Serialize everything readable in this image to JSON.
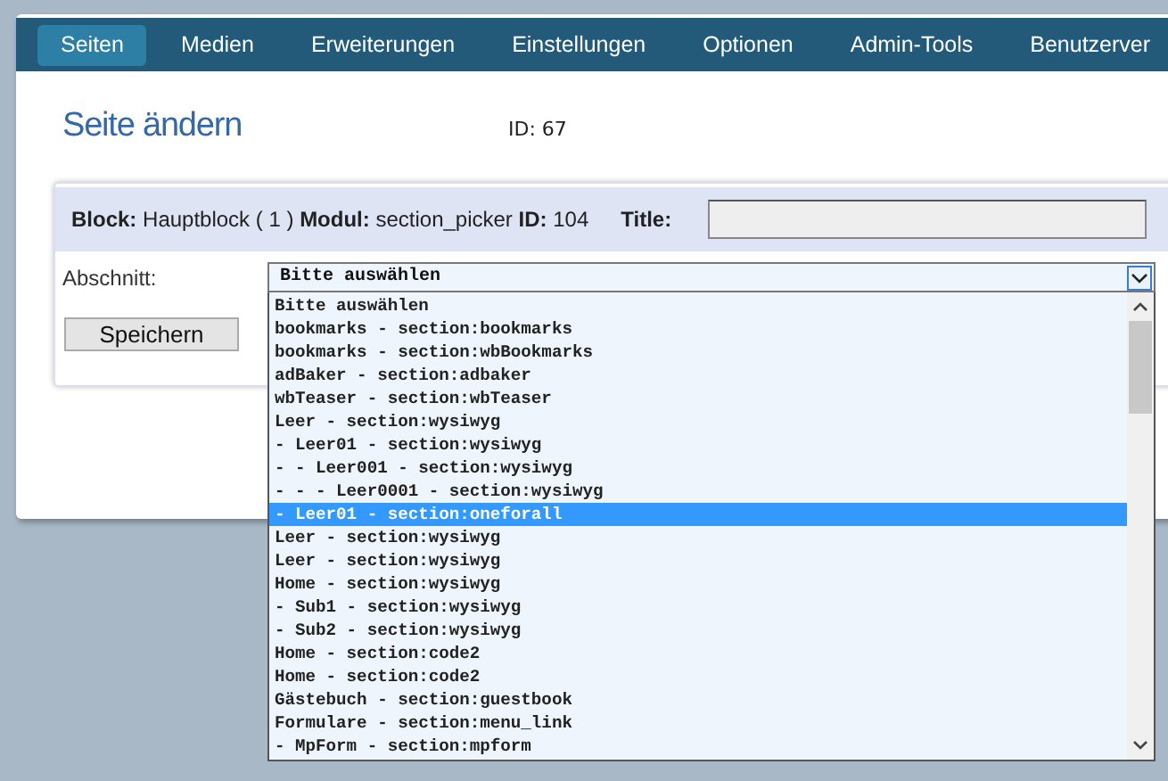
{
  "nav": [
    {
      "label": "Seiten",
      "selected": true
    },
    {
      "label": "Medien",
      "selected": false
    },
    {
      "label": "Erweiterungen",
      "selected": false
    },
    {
      "label": "Einstellungen",
      "selected": false
    },
    {
      "label": "Optionen",
      "selected": false
    },
    {
      "label": "Admin-Tools",
      "selected": false
    },
    {
      "label": "Benutzerver",
      "selected": false
    }
  ],
  "page_title": "Seite ändern",
  "page_id": "ID: 67",
  "block_header": {
    "text": "**Block:** Hauptblock ( 1 ) **Modul:** section_picker **ID:** 104",
    "title_label": "Title:"
  },
  "section_field": {
    "label": "Abschnitt:",
    "value": "Bitte auswählen"
  },
  "options": [
    {
      "label": "Bitte auswählen",
      "selected": false
    },
    {
      "label": "bookmarks - section:bookmarks",
      "selected": false
    },
    {
      "label": "bookmarks - section:wbBookmarks",
      "selected": false
    },
    {
      "label": "adBaker - section:adbaker",
      "selected": false
    },
    {
      "label": "wbTeaser - section:wbTeaser",
      "selected": false
    },
    {
      "label": "Leer - section:wysiwyg",
      "selected": false
    },
    {
      "label": "- Leer01 - section:wysiwyg",
      "selected": false
    },
    {
      "label": "- - Leer001 - section:wysiwyg",
      "selected": false
    },
    {
      "label": "- - - Leer0001 - section:wysiwyg",
      "selected": false
    },
    {
      "label": "- Leer01 - section:oneforall",
      "selected": true
    },
    {
      "label": "Leer - section:wysiwyg",
      "selected": false
    },
    {
      "label": "Leer - section:wysiwyg",
      "selected": false
    },
    {
      "label": "Home - section:wysiwyg",
      "selected": false
    },
    {
      "label": "- Sub1 - section:wysiwyg",
      "selected": false
    },
    {
      "label": "- Sub2 - section:wysiwyg",
      "selected": false
    },
    {
      "label": "Home - section:code2",
      "selected": false
    },
    {
      "label": "Home - section:code2",
      "selected": false
    },
    {
      "label": "Gästebuch - section:guestbook",
      "selected": false
    },
    {
      "label": "Formulare - section:menu_link",
      "selected": false
    },
    {
      "label": "- MpForm - section:mpform",
      "selected": false
    }
  ],
  "save_button": "Speichern"
}
